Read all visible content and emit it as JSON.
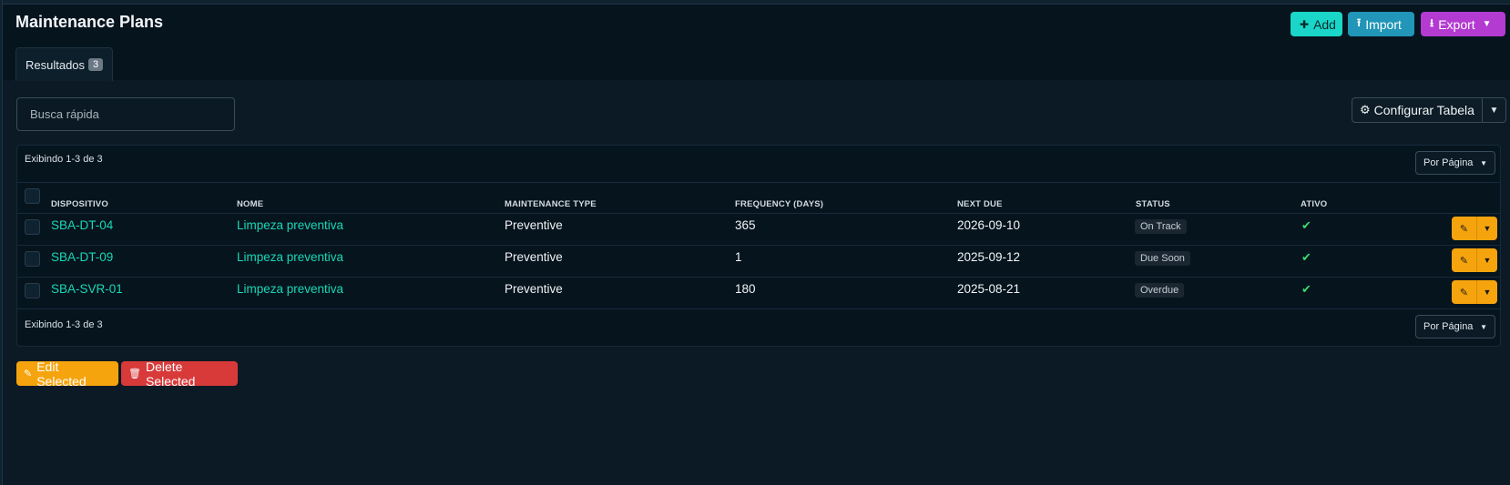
{
  "header": {
    "title": "Maintenance Plans",
    "add_label": "Add",
    "import_label": "Import",
    "export_label": "Export"
  },
  "tab": {
    "label": "Resultados",
    "count": "3"
  },
  "search": {
    "placeholder": "Busca rápida",
    "value": ""
  },
  "config_table": {
    "label": "Configurar Tabela"
  },
  "pagination": {
    "info_top": "Exibindo 1-3 de 3",
    "info_bottom": "Exibindo 1-3 de 3",
    "per_page_label": "Por Página"
  },
  "table": {
    "columns": [
      "DISPOSITIVO",
      "NOME",
      "MAINTENANCE TYPE",
      "FREQUENCY (DAYS)",
      "NEXT DUE",
      "STATUS",
      "ATIVO"
    ],
    "rows": [
      {
        "device": "SBA-DT-04",
        "name": "Limpeza preventiva",
        "type": "Preventive",
        "frequency": "365",
        "next_due": "2026-09-10",
        "status": "On Track",
        "active": "✔"
      },
      {
        "device": "SBA-DT-09",
        "name": "Limpeza preventiva",
        "type": "Preventive",
        "frequency": "1",
        "next_due": "2025-09-12",
        "status": "Due Soon",
        "active": "✔"
      },
      {
        "device": "SBA-SVR-01",
        "name": "Limpeza preventiva",
        "type": "Preventive",
        "frequency": "180",
        "next_due": "2025-08-21",
        "status": "Overdue",
        "active": "✔"
      }
    ]
  },
  "bulk": {
    "edit_label": "Edit Selected",
    "delete_label": "Delete Selected"
  },
  "colors": {
    "background": "#0b1a24",
    "link": "#19d8b6",
    "add": "#1ad6c8",
    "import": "#2196b8",
    "export": "#b43bd1",
    "edit": "#f5a40d",
    "delete": "#d83a3a",
    "check": "#3bd96b"
  }
}
